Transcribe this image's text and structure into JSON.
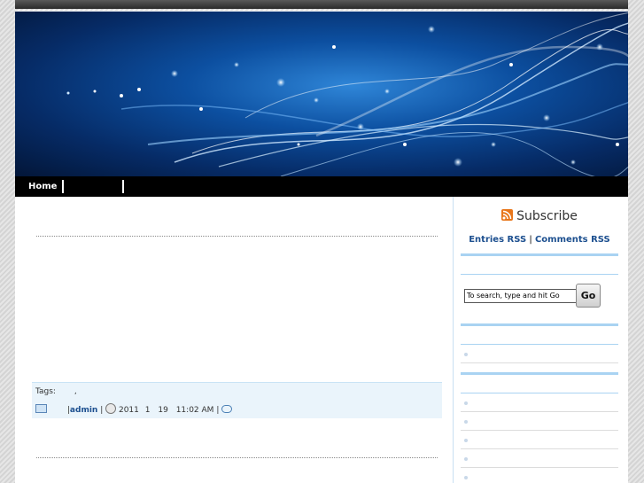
{
  "nav": {
    "items": [
      {
        "label": "Home"
      },
      {
        "label": ""
      },
      {
        "label": ""
      }
    ]
  },
  "post": {
    "tags_label": "Tags:",
    "tags_value": ",",
    "author": "admin",
    "date_year": "2011",
    "date_month": "1",
    "date_day": "19",
    "time": "11:02 AM",
    "sep": "|"
  },
  "sidebar": {
    "subscribe_title": "Subscribe",
    "entries_rss": "Entries RSS",
    "comments_rss": "Comments RSS",
    "rss_sep": "|",
    "search_placeholder": "To search, type and hit Go",
    "go_label": "Go",
    "bullet_char": "·"
  },
  "colors": {
    "link": "#1c4f8f",
    "accent_line": "#a9d3f2",
    "nav_bg": "#000000",
    "rss": "#e8761a"
  }
}
